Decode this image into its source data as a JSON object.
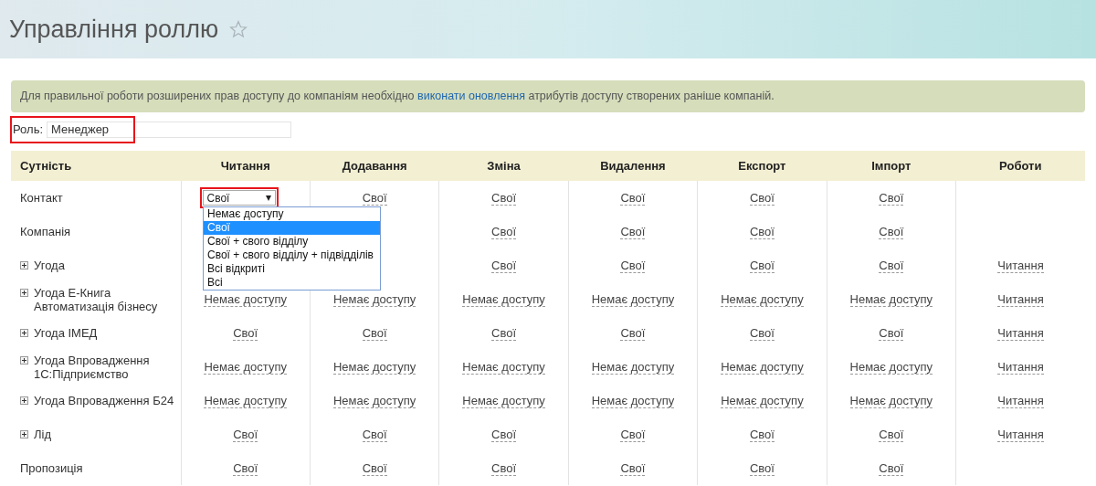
{
  "page": {
    "title": "Управління роллю",
    "favorite": false
  },
  "notice": {
    "before": "Для правильної роботи розширених прав доступу до компаніям необхідно ",
    "link": "виконати оновлення",
    "after": " атрибутів доступу створених раніше компаній."
  },
  "role": {
    "label": "Роль:",
    "value": "Менеджер",
    "highlighted": true
  },
  "table": {
    "entity_column": "Сутність",
    "columns": [
      "Читання",
      "Додавання",
      "Зміна",
      "Видалення",
      "Експорт",
      "Імпорт",
      "Роботи"
    ],
    "rows": [
      {
        "entity": "Контакт",
        "expandable": false,
        "cells": [
          {
            "kind": "select",
            "value": "Свої",
            "highlighted": true
          },
          "Свої",
          "Свої",
          "Свої",
          "Свої",
          "Свої",
          null
        ]
      },
      {
        "entity": "Компанія",
        "expandable": false,
        "cells": [
          null,
          null,
          "Свої",
          "Свої",
          "Свої",
          "Свої",
          null
        ]
      },
      {
        "entity": "Угода",
        "expandable": true,
        "cells": [
          null,
          null,
          "Свої",
          "Свої",
          "Свої",
          "Свої",
          "Читання"
        ]
      },
      {
        "entity": "Угода Е-Книга Автоматизація бізнесу",
        "expandable": true,
        "cells": [
          "Немає доступу",
          "Немає доступу",
          "Немає доступу",
          "Немає доступу",
          "Немає доступу",
          "Немає доступу",
          "Читання"
        ]
      },
      {
        "entity": "Угода IMЕД",
        "expandable": true,
        "cells": [
          "Свої",
          "Свої",
          "Свої",
          "Свої",
          "Свої",
          "Свої",
          "Читання"
        ]
      },
      {
        "entity": "Угода Впровадження 1С:Підприємство",
        "expandable": true,
        "cells": [
          "Немає доступу",
          "Немає доступу",
          "Немає доступу",
          "Немає доступу",
          "Немає доступу",
          "Немає доступу",
          "Читання"
        ]
      },
      {
        "entity": "Угода Впровадження Б24",
        "expandable": true,
        "cells": [
          "Немає доступу",
          "Немає доступу",
          "Немає доступу",
          "Немає доступу",
          "Немає доступу",
          "Немає доступу",
          "Читання"
        ]
      },
      {
        "entity": "Лід",
        "expandable": true,
        "cells": [
          "Свої",
          "Свої",
          "Свої",
          "Свої",
          "Свої",
          "Свої",
          "Читання"
        ]
      },
      {
        "entity": "Пропозиція",
        "expandable": false,
        "cells": [
          "Свої",
          "Свої",
          "Свої",
          "Свої",
          "Свої",
          "Свої",
          null
        ]
      }
    ]
  },
  "dropdown": {
    "options": [
      {
        "label": "Немає доступу",
        "selected": false
      },
      {
        "label": "Свої",
        "selected": true
      },
      {
        "label": "Свої + свого відділу",
        "selected": false
      },
      {
        "label": "Свої + свого відділу + підвідділів",
        "selected": false
      },
      {
        "label": "Всі відкриті",
        "selected": false
      },
      {
        "label": "Всі",
        "selected": false
      }
    ]
  }
}
